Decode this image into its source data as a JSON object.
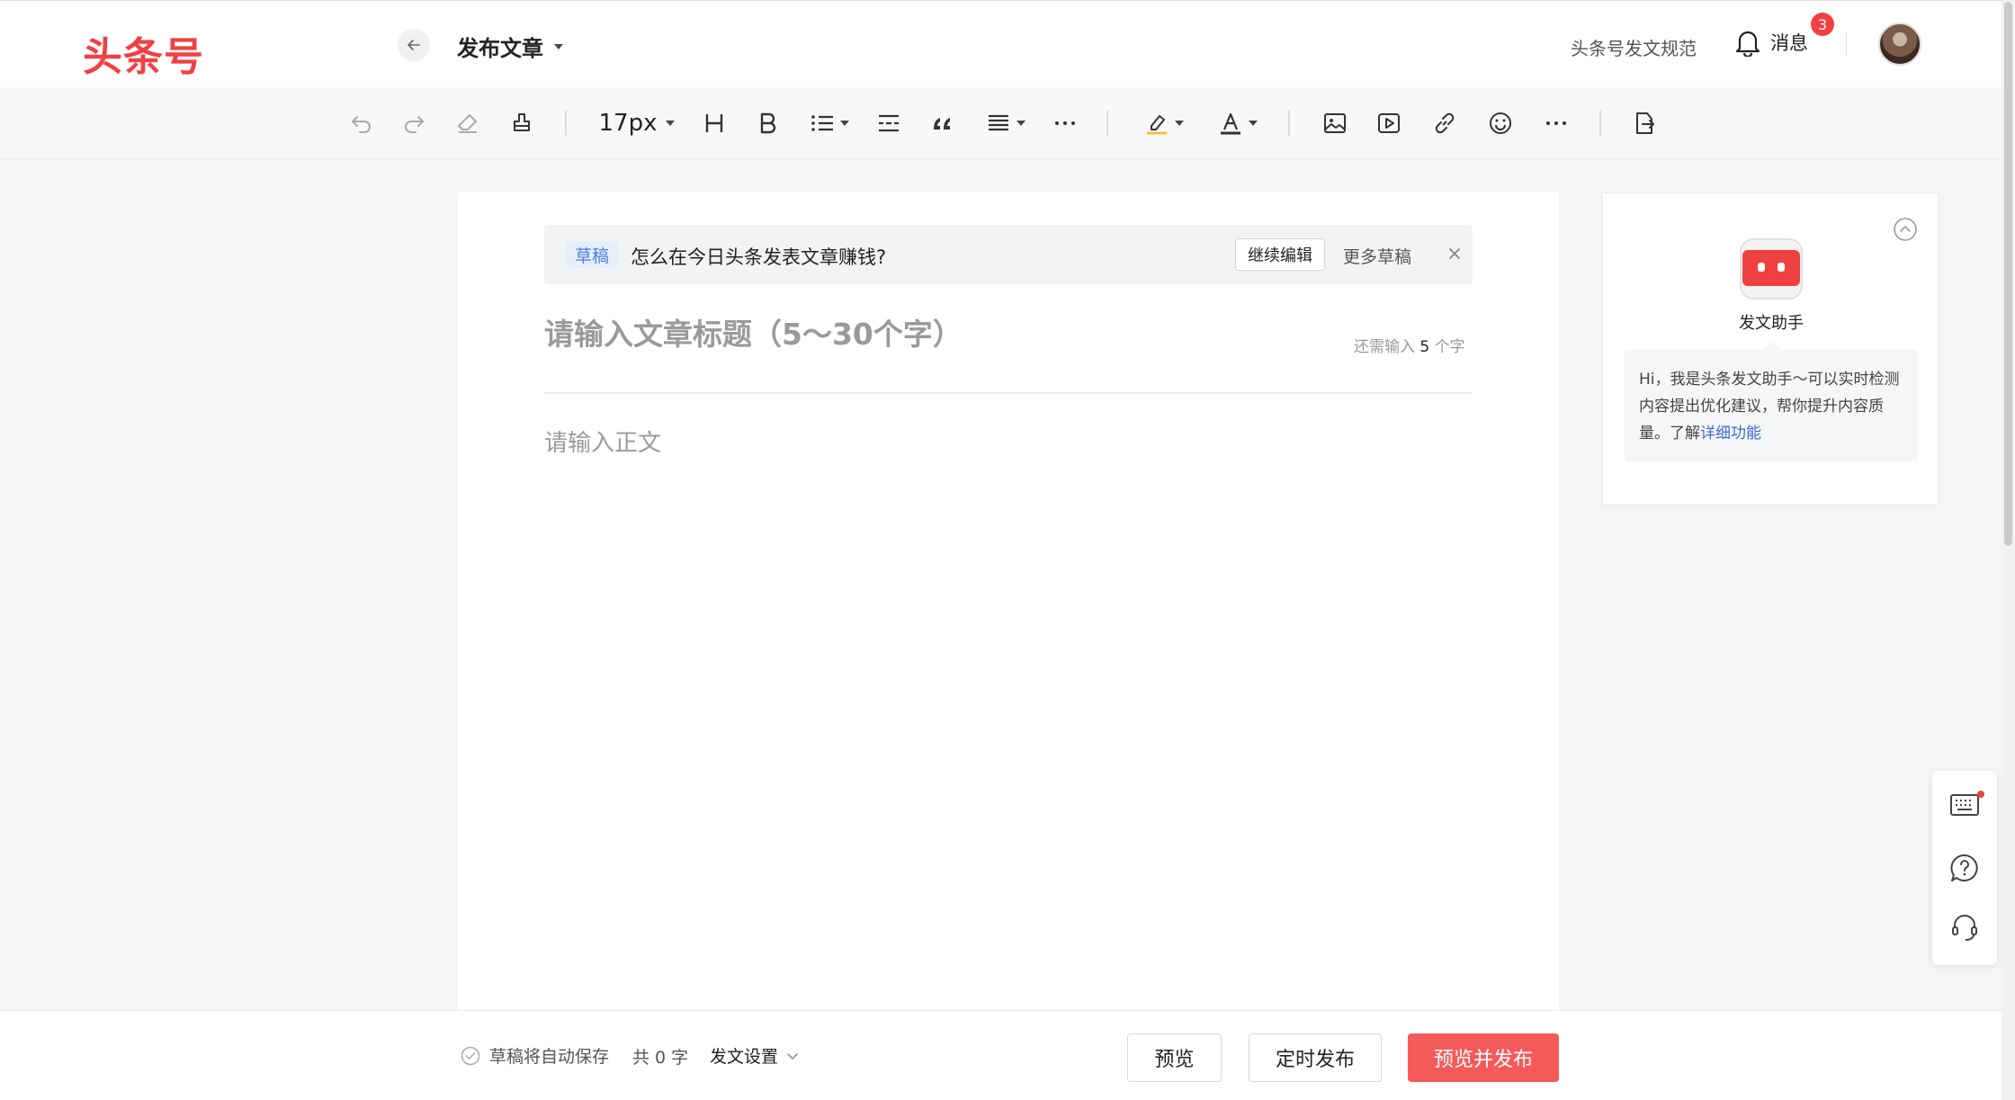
{
  "header": {
    "logo": "头条号",
    "page_title": "发布文章",
    "rules_link": "头条号发文规范",
    "messages_label": "消息",
    "messages_badge": "3"
  },
  "toolbar": {
    "font_size": "17px",
    "items": [
      "undo-icon",
      "redo-icon",
      "eraser-icon",
      "format-painter-icon",
      "font-size",
      "heading-icon",
      "bold-icon",
      "list-icon",
      "divider-icon",
      "quote-icon",
      "align-icon",
      "more-icon",
      "highlight-icon",
      "font-color-icon",
      "image-icon",
      "video-icon",
      "link-icon",
      "emoji-icon",
      "more-icon",
      "import-doc-icon"
    ]
  },
  "draft": {
    "tag": "草稿",
    "title": "怎么在今日头条发表文章赚钱?",
    "continue_label": "继续编辑",
    "more_label": "更多草稿"
  },
  "editor": {
    "title_placeholder": "请输入文章标题（5～30个字）",
    "remain_prefix": "还需输入",
    "remain_count": "5",
    "remain_suffix": "个字",
    "body_placeholder": "请输入正文"
  },
  "assistant": {
    "name": "发文助手",
    "intro": "Hi，我是头条发文助手～可以实时检测内容提出优化建议，帮你提升内容质量。了解",
    "link": "详细功能"
  },
  "footer": {
    "autosave": "草稿将自动保存",
    "word_count": "共 0 字",
    "settings": "发文设置",
    "preview": "预览",
    "schedule": "定时发布",
    "preview_publish": "预览并发布"
  },
  "colors": {
    "brand_red": "#f04142",
    "primary_button": "#f55a5a",
    "link_blue": "#3b6bd6"
  }
}
